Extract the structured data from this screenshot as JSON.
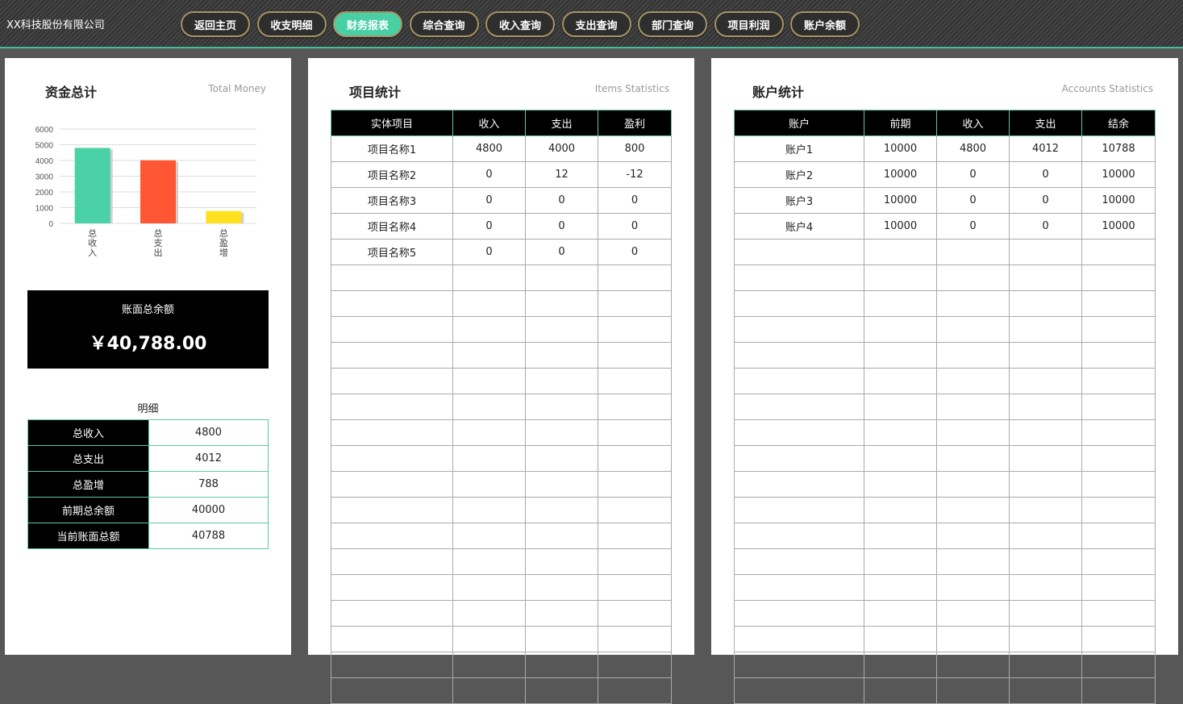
{
  "header": {
    "company": "XX科技股份有限公司",
    "nav": [
      {
        "label": "返回主页",
        "active": false
      },
      {
        "label": "收支明细",
        "active": false
      },
      {
        "label": "财务报表",
        "active": true
      },
      {
        "label": "综合查询",
        "active": false
      },
      {
        "label": "收入查询",
        "active": false
      },
      {
        "label": "支出查询",
        "active": false
      },
      {
        "label": "部门查询",
        "active": false
      },
      {
        "label": "项目利润",
        "active": false
      },
      {
        "label": "账户余额",
        "active": false
      }
    ]
  },
  "money": {
    "title": "资金总计",
    "subtitle": "Total Money",
    "balance_label": "账面总余额",
    "balance_value": "￥40,788.00",
    "detail_title": "明细",
    "details": [
      {
        "label": "总收入",
        "value": "4800"
      },
      {
        "label": "总支出",
        "value": "4012"
      },
      {
        "label": "总盈增",
        "value": "788"
      },
      {
        "label": "前期总余额",
        "value": "40000"
      },
      {
        "label": "当前账面总额",
        "value": "40788"
      }
    ]
  },
  "chart_data": {
    "type": "bar",
    "categories": [
      "总收入",
      "总支出",
      "总盈增"
    ],
    "values": [
      4800,
      4012,
      788
    ],
    "ylim": [
      0,
      6000
    ],
    "yticks": [
      0,
      1000,
      2000,
      3000,
      4000,
      5000,
      6000
    ],
    "colors": [
      "#4bd1a6",
      "#ff5633",
      "#ffe01f"
    ],
    "grid": true
  },
  "items": {
    "title": "项目统计",
    "subtitle": "Items Statistics",
    "columns": [
      "实体项目",
      "收入",
      "支出",
      "盈利"
    ],
    "rows": [
      [
        "项目名称1",
        "4800",
        "4000",
        "800"
      ],
      [
        "项目名称2",
        "0",
        "12",
        "-12"
      ],
      [
        "项目名称3",
        "0",
        "0",
        "0"
      ],
      [
        "项目名称4",
        "0",
        "0",
        "0"
      ],
      [
        "项目名称5",
        "0",
        "0",
        "0"
      ]
    ]
  },
  "accounts": {
    "title": "账户统计",
    "subtitle": "Accounts Statistics",
    "columns": [
      "账户",
      "前期",
      "收入",
      "支出",
      "结余"
    ],
    "rows": [
      [
        "账户1",
        "10000",
        "4800",
        "4012",
        "10788"
      ],
      [
        "账户2",
        "10000",
        "0",
        "0",
        "10000"
      ],
      [
        "账户3",
        "10000",
        "0",
        "0",
        "10000"
      ],
      [
        "账户4",
        "10000",
        "0",
        "0",
        "10000"
      ]
    ]
  }
}
